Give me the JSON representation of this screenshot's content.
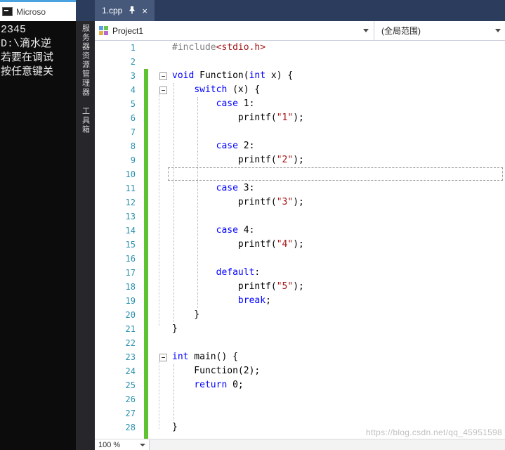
{
  "console": {
    "title": "Microso",
    "output_lines": [
      "2345",
      "D:\\滴水逆",
      "若要在调试",
      "按任意键关"
    ]
  },
  "side_tab_strip": {
    "tabs": [
      {
        "label": "服务器资源管理器"
      },
      {
        "label": "工具箱"
      }
    ]
  },
  "tab_bar": {
    "tabs": [
      {
        "label": "1.cpp",
        "pinned": true,
        "active": true,
        "close_glyph": "×"
      }
    ]
  },
  "nav_bar": {
    "project_selector": "Project1",
    "scope_selector": "(全局范围)"
  },
  "editor": {
    "language": "cpp",
    "current_line": 10,
    "zoom": "100 %",
    "lines": [
      {
        "n": 1,
        "tokens": [
          [
            "pre",
            "#include"
          ],
          [
            "str",
            "<stdio.h>"
          ]
        ]
      },
      {
        "n": 2,
        "tokens": []
      },
      {
        "n": 3,
        "fold": true,
        "tokens": [
          [
            "kw",
            "void"
          ],
          [
            "pln",
            " Function("
          ],
          [
            "kw",
            "int"
          ],
          [
            "pln",
            " x) {"
          ]
        ]
      },
      {
        "n": 4,
        "fold": true,
        "tokens": [
          [
            "pln",
            "    "
          ],
          [
            "kw",
            "switch"
          ],
          [
            "pln",
            " (x) {"
          ]
        ]
      },
      {
        "n": 5,
        "tokens": [
          [
            "pln",
            "        "
          ],
          [
            "kw",
            "case"
          ],
          [
            "pln",
            " 1:"
          ]
        ]
      },
      {
        "n": 6,
        "tokens": [
          [
            "pln",
            "            printf("
          ],
          [
            "str",
            "\"1\""
          ],
          [
            "pln",
            ");"
          ]
        ]
      },
      {
        "n": 7,
        "tokens": []
      },
      {
        "n": 8,
        "tokens": [
          [
            "pln",
            "        "
          ],
          [
            "kw",
            "case"
          ],
          [
            "pln",
            " 2:"
          ]
        ]
      },
      {
        "n": 9,
        "tokens": [
          [
            "pln",
            "            printf("
          ],
          [
            "str",
            "\"2\""
          ],
          [
            "pln",
            ");"
          ]
        ]
      },
      {
        "n": 10,
        "tokens": []
      },
      {
        "n": 11,
        "tokens": [
          [
            "pln",
            "        "
          ],
          [
            "kw",
            "case"
          ],
          [
            "pln",
            " 3:"
          ]
        ]
      },
      {
        "n": 12,
        "tokens": [
          [
            "pln",
            "            printf("
          ],
          [
            "str",
            "\"3\""
          ],
          [
            "pln",
            ");"
          ]
        ]
      },
      {
        "n": 13,
        "tokens": []
      },
      {
        "n": 14,
        "tokens": [
          [
            "pln",
            "        "
          ],
          [
            "kw",
            "case"
          ],
          [
            "pln",
            " 4:"
          ]
        ]
      },
      {
        "n": 15,
        "tokens": [
          [
            "pln",
            "            printf("
          ],
          [
            "str",
            "\"4\""
          ],
          [
            "pln",
            ");"
          ]
        ]
      },
      {
        "n": 16,
        "tokens": []
      },
      {
        "n": 17,
        "tokens": [
          [
            "pln",
            "        "
          ],
          [
            "kw",
            "default"
          ],
          [
            "pln",
            ":"
          ]
        ]
      },
      {
        "n": 18,
        "tokens": [
          [
            "pln",
            "            printf("
          ],
          [
            "str",
            "\"5\""
          ],
          [
            "pln",
            ");"
          ]
        ]
      },
      {
        "n": 19,
        "tokens": [
          [
            "pln",
            "            "
          ],
          [
            "kw",
            "break"
          ],
          [
            "pln",
            ";"
          ]
        ]
      },
      {
        "n": 20,
        "tokens": [
          [
            "pln",
            "    }"
          ]
        ]
      },
      {
        "n": 21,
        "tokens": [
          [
            "pln",
            "}"
          ]
        ]
      },
      {
        "n": 22,
        "tokens": []
      },
      {
        "n": 23,
        "fold": true,
        "tokens": [
          [
            "kw",
            "int"
          ],
          [
            "pln",
            " main() {"
          ]
        ]
      },
      {
        "n": 24,
        "tokens": [
          [
            "pln",
            "    Function(2);"
          ]
        ]
      },
      {
        "n": 25,
        "tokens": [
          [
            "pln",
            "    "
          ],
          [
            "kw",
            "return"
          ],
          [
            "pln",
            " 0;"
          ]
        ]
      },
      {
        "n": 26,
        "tokens": []
      },
      {
        "n": 27,
        "tokens": []
      },
      {
        "n": 28,
        "tokens": [
          [
            "pln",
            "}"
          ]
        ]
      }
    ]
  },
  "watermark": "https://blog.csdn.net/qq_45951598",
  "colors": {
    "keyword": "#0000ff",
    "string": "#a31515",
    "preprocessor": "#808080",
    "line_number": "#2b91af",
    "change_tracking_green": "#5ec232",
    "tab_bar_bg": "#2b3c5c",
    "active_tab_bg": "#46597b"
  }
}
